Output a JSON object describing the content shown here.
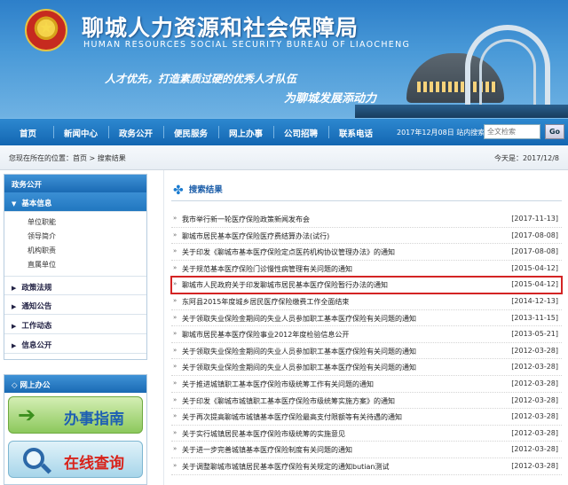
{
  "banner": {
    "title": "聊城人力资源和社会保障局",
    "subtitle": "HUMAN RESOURCES SOCIAL SECURITY BUREAU OF LIAOCHENG",
    "slogan_1": "人才优先，打造素质过硬的优秀人才队伍",
    "slogan_2": "为聊城发展添动力"
  },
  "nav": {
    "items": [
      "首页",
      "新闻中心",
      "政务公开",
      "便民服务",
      "网上办事",
      "公司招聘",
      "联系电话"
    ],
    "date_text": "2017年12月08日  站内搜索",
    "search_placeholder": "全文检索",
    "search_button": "Go"
  },
  "breadcrumb": {
    "prefix": "您现在所在的位置：",
    "home": "首页",
    "sep": " > ",
    "current": "搜索结果",
    "today": "今天是：2017/12/8"
  },
  "sidebar": {
    "header": "政务公开",
    "sections": [
      {
        "label": "基本信息",
        "active": true,
        "sub": [
          "单位职能",
          "领导简介",
          "机构职责",
          "直属单位"
        ]
      },
      {
        "label": "政策法规"
      },
      {
        "label": "通知公告"
      },
      {
        "label": "工作动态"
      },
      {
        "label": "信息公开"
      }
    ],
    "online_header": "网上办公",
    "quick_links": [
      "办事指南",
      "在线查询"
    ]
  },
  "content": {
    "title": "搜索结果",
    "results": [
      {
        "title": "我市举行新一轮医疗保险政策新闻发布会",
        "date": "[2017-11-13]"
      },
      {
        "title": "聊城市居民基本医疗保险医疗费结算办法(试行)",
        "date": "[2017-08-08]"
      },
      {
        "title": "关于印发《聊城市基本医疗保险定点医药机构协议管理办法》的通知",
        "date": "[2017-08-08]"
      },
      {
        "title": "关于规范基本医疗保险门诊慢性病管理有关问题的通知",
        "date": "[2015-04-12]"
      },
      {
        "title": "聊城市人民政府关于印发聊城市居民基本医疗保险暂行办法的通知",
        "date": "[2015-04-12]",
        "highlight": true
      },
      {
        "title": "东阿县2015年度城乡居民医疗保险缴费工作全面结束",
        "date": "[2014-12-13]"
      },
      {
        "title": "关于领取失业保险金期间的失业人员参加职工基本医疗保险有关问题的通知",
        "date": "[2013-11-15]"
      },
      {
        "title": "聊城市居民基本医疗保险事业2012年度检验信息公开",
        "date": "[2013-05-21]"
      },
      {
        "title": "关于领取失业保险金期间的失业人员参加职工基本医疗保险有关问题的通知",
        "date": "[2012-03-28]"
      },
      {
        "title": "关于领取失业保险金期间的失业人员参加职工基本医疗保险有关问题的通知",
        "date": "[2012-03-28]"
      },
      {
        "title": "关于推进城镇职工基本医疗保险市级统筹工作有关问题的通知",
        "date": "[2012-03-28]"
      },
      {
        "title": "关于印发《聊城市城镇职工基本医疗保险市级统筹实施方案》的通知",
        "date": "[2012-03-28]"
      },
      {
        "title": "关于再次提高聊城市城镇基本医疗保险最高支付限额等有关待遇的通知",
        "date": "[2012-03-28]"
      },
      {
        "title": "关于实行城镇居民基本医疗保险市级统筹的实施意见",
        "date": "[2012-03-28]"
      },
      {
        "title": "关于进一步完善城镇基本医疗保险制度有关问题的通知",
        "date": "[2012-03-28]"
      },
      {
        "title": "关于调整聊城市城镇居民基本医疗保险有关规定的通知butian测试",
        "date": "[2012-03-28]"
      }
    ]
  },
  "colors": {
    "nav_bg": "#1a74bf",
    "highlight_border": "#d42424",
    "title_blue": "#1a5ca8"
  }
}
